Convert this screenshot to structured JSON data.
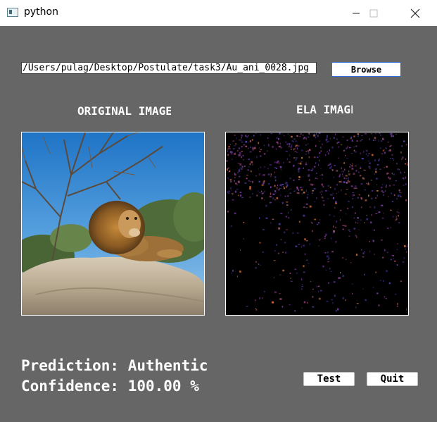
{
  "window": {
    "title": "python"
  },
  "file": {
    "path": "/Users/pulag/Desktop/Postulate/task3/Au_ani_0028.jpg"
  },
  "buttons": {
    "browse": "Browse",
    "test": "Test",
    "quit": "Quit"
  },
  "captions": {
    "original": "ORIGINAL IMAGE",
    "ela": "ELA IMAGE"
  },
  "result": {
    "prediction": "Prediction: Authentic",
    "confidence": "Confidence: 100.00 %"
  },
  "colors": {
    "background": "#666666",
    "accent": "#2f6fd6"
  },
  "icons": {
    "app": "python-window-icon",
    "minimize": "minimize-icon",
    "maximize": "maximize-icon",
    "close": "close-icon"
  }
}
